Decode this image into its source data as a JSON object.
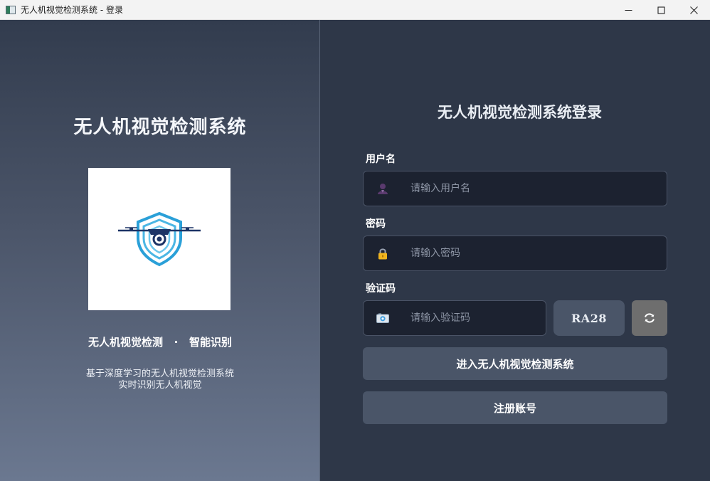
{
  "window": {
    "title": "无人机视觉检测系统 - 登录",
    "minimize_icon": "minimize-icon",
    "maximize_icon": "maximize-icon",
    "close_icon": "close-icon"
  },
  "brand": {
    "title": "无人机视觉检测系统",
    "slogan": "无人机视觉检测   ·   智能识别",
    "description_line1": "基于深度学习的无人机视觉检测系统",
    "description_line2": "实时识别无人机视觉",
    "logo_icon": "drone-shield-logo-icon",
    "colors": {
      "logo_blue": "#2aa0d8",
      "logo_navy": "#1d3466"
    }
  },
  "login": {
    "title": "无人机视觉检测系统登录",
    "username": {
      "label": "用户名",
      "placeholder": "请输入用户名",
      "value": "",
      "icon": "user-icon"
    },
    "password": {
      "label": "密码",
      "placeholder": "请输入密码",
      "value": "",
      "icon": "lock-icon"
    },
    "captcha": {
      "label": "验证码",
      "placeholder": "请输入验证码",
      "value": "",
      "icon": "camera-icon",
      "code": "RA28",
      "refresh_icon": "refresh-icon"
    },
    "submit_label": "进入无人机视觉检测系统",
    "register_label": "注册账号"
  },
  "colors": {
    "panel_bg": "#2e3748",
    "input_bg": "#1c2230",
    "button_bg": "#4a5568",
    "refresh_bg": "#6e6e6e",
    "lock_color": "#f0b41e"
  }
}
